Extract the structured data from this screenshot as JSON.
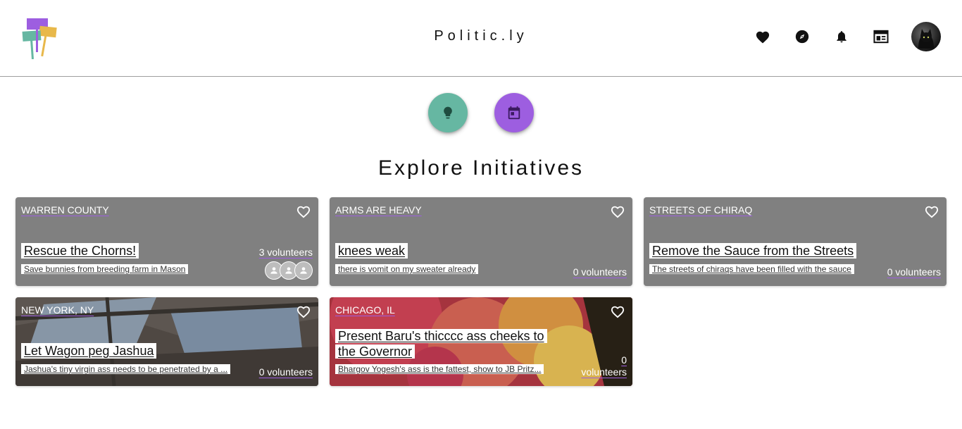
{
  "app": {
    "brand": "Politic.ly"
  },
  "nav": {
    "icons": [
      "heart-icon",
      "compass-icon",
      "bell-icon",
      "newspaper-icon",
      "avatar"
    ]
  },
  "actions": {
    "idea_icon": "lightbulb-icon",
    "event_icon": "calendar-icon"
  },
  "page": {
    "title": "Explore Initiatives"
  },
  "colors": {
    "teal": "#66b7a2",
    "purple": "#9d5ee0",
    "card_gray": "#808080"
  },
  "cards": [
    {
      "location": "WARREN COUNTY",
      "title": "Rescue the Chorns!",
      "description": "Save bunnies from breeding farm in Mason",
      "volunteers": "3 volunteers"
    },
    {
      "location": "ARMS ARE HEAVY",
      "title": "knees weak",
      "description": "there is vomit on my sweater already",
      "volunteers": "0 volunteers"
    },
    {
      "location": "STREETS OF CHIRAQ",
      "title": "Remove the Sauce from the Streets",
      "description": "The streets of chiraqs have been filled with the sauce",
      "volunteers": "0 volunteers"
    },
    {
      "location": "NEW YORK, NY",
      "title": "Let Wagon peg Jashua",
      "description": "Jashua's tiny virgin ass needs to be penetrated by a ...",
      "volunteers": "0 volunteers"
    },
    {
      "location": "CHICAGO, IL",
      "title": "Present Baru's thicccc ass cheeks to the Governor",
      "description": "Bhargov Yogesh's ass is the fattest, show to JB Pritz...",
      "volunteers_count": "0",
      "volunteers_label": "volunteers"
    }
  ]
}
